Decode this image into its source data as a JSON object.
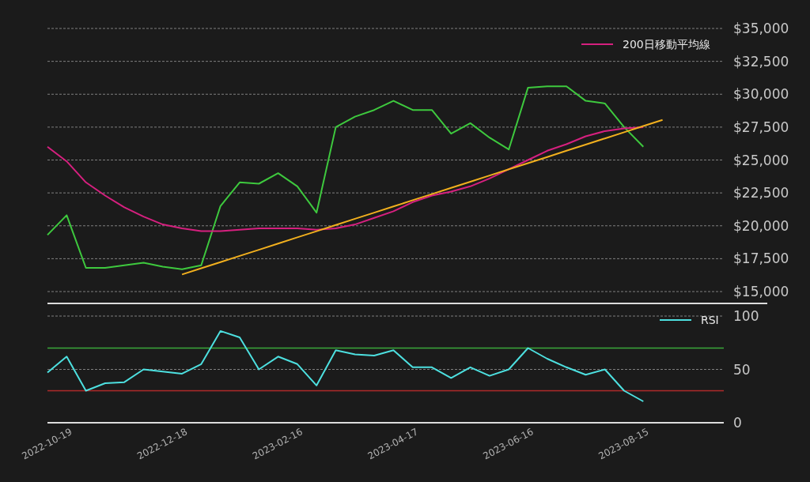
{
  "price_chart": {
    "chart_data": {
      "type": "line",
      "categories": [
        null,
        null,
        null,
        null,
        null,
        null,
        null,
        null,
        null,
        null,
        null,
        null,
        null,
        null,
        null,
        null,
        null,
        null,
        null,
        null,
        null,
        null,
        null,
        null,
        null,
        null,
        null,
        null,
        null,
        null,
        null,
        null,
        null
      ],
      "series": [
        {
          "color": "#3ec93e",
          "values": [
            19300,
            20800,
            16800,
            16800,
            17000,
            17200,
            16900,
            16700,
            17000,
            21500,
            23300,
            23200,
            24000,
            23000,
            21000,
            27500,
            28300,
            28800,
            29500,
            28800,
            28800,
            27000,
            27800,
            26700,
            25800,
            30500,
            30600,
            30600,
            29500,
            29300,
            27500,
            26000,
            null
          ]
        },
        {
          "name": "200日移動平均線",
          "color": "#d6207f",
          "values": [
            26000,
            24900,
            23300,
            22300,
            21400,
            20700,
            20100,
            19800,
            19600,
            19600,
            19700,
            19800,
            19800,
            19800,
            19700,
            19800,
            20100,
            20600,
            21100,
            21800,
            22300,
            22600,
            23000,
            23600,
            24300,
            25000,
            25700,
            26200,
            26800,
            27200,
            27400,
            27500,
            null
          ]
        },
        {
          "color": "#f2b01e",
          "values": [
            null,
            null,
            null,
            null,
            null,
            null,
            null,
            16300,
            16770,
            17240,
            17710,
            18180,
            18650,
            19120,
            19590,
            20060,
            20530,
            21000,
            21470,
            21940,
            22410,
            22880,
            23350,
            23820,
            24290,
            24760,
            25230,
            25700,
            26170,
            26640,
            27110,
            27580,
            28050
          ]
        }
      ],
      "ylim": [
        15000,
        35000
      ],
      "grid": true,
      "yticks": [
        {
          "value": 15000,
          "label": "$15,000"
        },
        {
          "value": 17500,
          "label": "$17,500"
        },
        {
          "value": 20000,
          "label": "$20,000"
        },
        {
          "value": 22500,
          "label": "$22,500"
        },
        {
          "value": 25000,
          "label": "$25,000"
        },
        {
          "value": 27500,
          "label": "$27,500"
        },
        {
          "value": 30000,
          "label": "$30,000"
        },
        {
          "value": 32500,
          "label": "$32,500"
        },
        {
          "value": 35000,
          "label": "$35,000"
        }
      ]
    }
  },
  "rsi_chart": {
    "chart_data": {
      "type": "line",
      "categories": [
        "2022-10-19",
        null,
        null,
        null,
        null,
        null,
        "2022-12-18",
        null,
        null,
        null,
        null,
        null,
        "2023-02-16",
        null,
        null,
        null,
        null,
        null,
        "2023-04-17",
        null,
        null,
        null,
        null,
        null,
        "2023-06-16",
        null,
        null,
        null,
        null,
        null,
        "2023-08-15",
        null,
        null
      ],
      "series": [
        {
          "name": "RSI",
          "color": "#4de0e0",
          "values": [
            47,
            62,
            30,
            37,
            38,
            50,
            48,
            46,
            55,
            86,
            80,
            50,
            62,
            55,
            35,
            68,
            64,
            63,
            68,
            52,
            52,
            42,
            52,
            44,
            50,
            70,
            60,
            52,
            45,
            50,
            30,
            20,
            null
          ]
        }
      ],
      "ylim": [
        0,
        100
      ],
      "yticks": [
        0,
        50,
        100
      ],
      "grid": true,
      "ref_lines": [
        {
          "axis": "y",
          "value": 70,
          "color": "#3aa83a"
        },
        {
          "axis": "y",
          "value": 30,
          "color": "#b02a2a"
        }
      ]
    }
  }
}
